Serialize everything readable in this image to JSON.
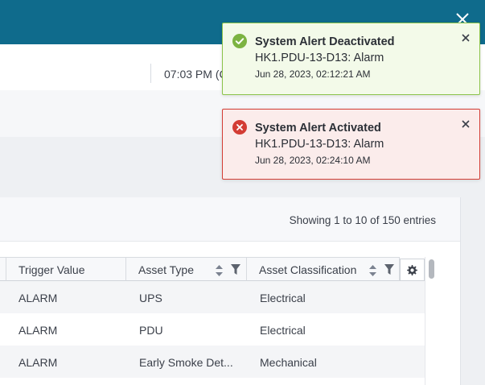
{
  "header": {
    "time": "07:03 PM (C"
  },
  "table": {
    "showing": "Showing 1 to 10 of 150 entries",
    "columns": [
      "Trigger Value",
      "Asset Type",
      "Asset Classification"
    ],
    "rows": [
      [
        "ALARM",
        "UPS",
        "Electrical"
      ],
      [
        "ALARM",
        "PDU",
        "Electrical"
      ],
      [
        "ALARM",
        "Early Smoke Det...",
        "Mechanical"
      ]
    ]
  },
  "toasts": [
    {
      "status": "success",
      "title": "System Alert Deactivated",
      "message": "HK1.PDU-13-D13: Alarm",
      "timestamp": "Jun 28, 2023, 02:12:21 AM"
    },
    {
      "status": "error",
      "title": "System Alert Activated",
      "message": "HK1.PDU-13-D13: Alarm",
      "timestamp": "Jun 28, 2023, 02:24:10 AM"
    }
  ],
  "colors": {
    "brand": "#0f6b8c",
    "success": "#8bc34a",
    "error": "#d33c34",
    "link": "#1a8fc9"
  }
}
